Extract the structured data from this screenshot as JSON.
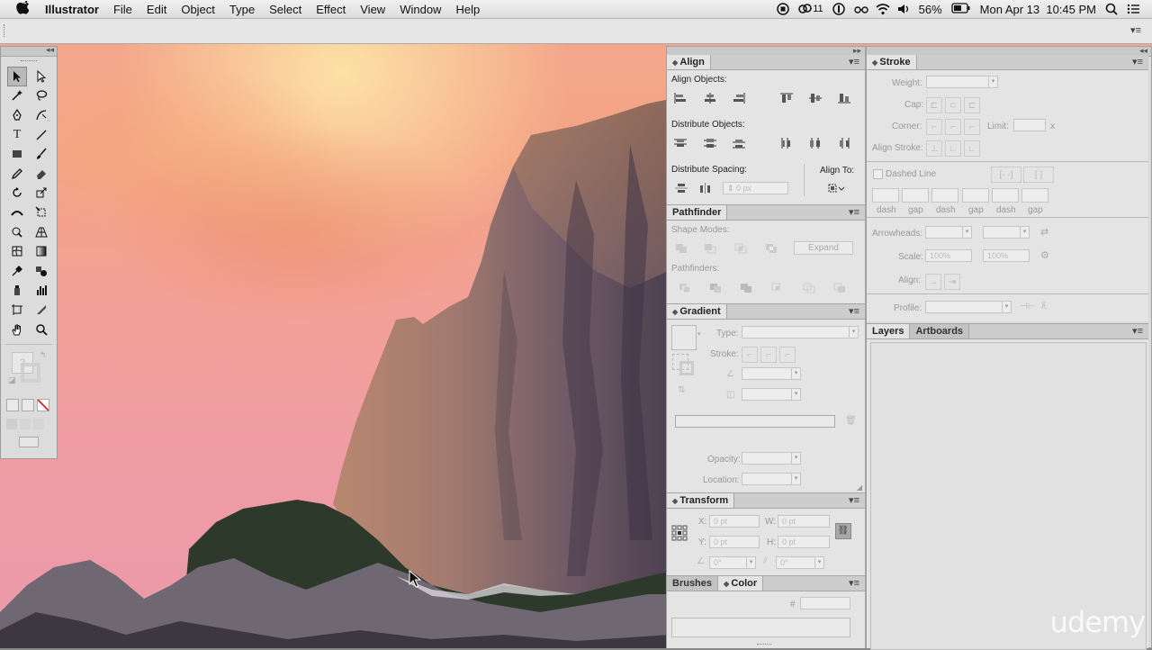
{
  "menubar": {
    "app_name": "Illustrator",
    "items": [
      "File",
      "Edit",
      "Object",
      "Type",
      "Select",
      "Effect",
      "View",
      "Window",
      "Help"
    ],
    "status_count": "11",
    "battery": "56%",
    "datetime": "Mon Apr 13  10:45 PM"
  },
  "align": {
    "tab": "Align",
    "align_objects": "Align Objects:",
    "distribute_objects": "Distribute Objects:",
    "distribute_spacing": "Distribute Spacing:",
    "align_to": "Align To:",
    "spacing_value": "0 px"
  },
  "pathfinder": {
    "tab": "Pathfinder",
    "shape_modes": "Shape Modes:",
    "expand": "Expand",
    "pathfinders": "Pathfinders:"
  },
  "gradient": {
    "tab": "Gradient",
    "type_label": "Type:",
    "stroke_label": "Stroke:",
    "opacity_label": "Opacity:",
    "location_label": "Location:"
  },
  "transform": {
    "tab": "Transform",
    "x_label": "X:",
    "x_value": "0 pt",
    "y_label": "Y:",
    "y_value": "0 pt",
    "w_label": "W:",
    "w_value": "0 pt",
    "h_label": "H:",
    "h_value": "0 pt",
    "rotate_value": "0°",
    "shear_value": "0°"
  },
  "brushes_color": {
    "tab_brushes": "Brushes",
    "tab_color": "Color",
    "hash": "#"
  },
  "stroke": {
    "tab": "Stroke",
    "weight": "Weight:",
    "cap": "Cap:",
    "corner": "Corner:",
    "limit": "Limit:",
    "limit_unit": "x",
    "align_stroke": "Align Stroke:",
    "dashed_line": "Dashed Line",
    "dash_labels": [
      "dash",
      "gap",
      "dash",
      "gap",
      "dash",
      "gap"
    ],
    "arrowheads": "Arrowheads:",
    "scale": "Scale:",
    "scale_value1": "100%",
    "scale_value2": "100%",
    "align": "Align:",
    "profile": "Profile:"
  },
  "layers": {
    "tab_layers": "Layers",
    "tab_artboards": "Artboards"
  },
  "watermark": "udemy",
  "colors": {
    "panel_bg": "#e4e4e4",
    "panel_header": "#c9c9c9",
    "menubar": "#e8e8e8"
  }
}
